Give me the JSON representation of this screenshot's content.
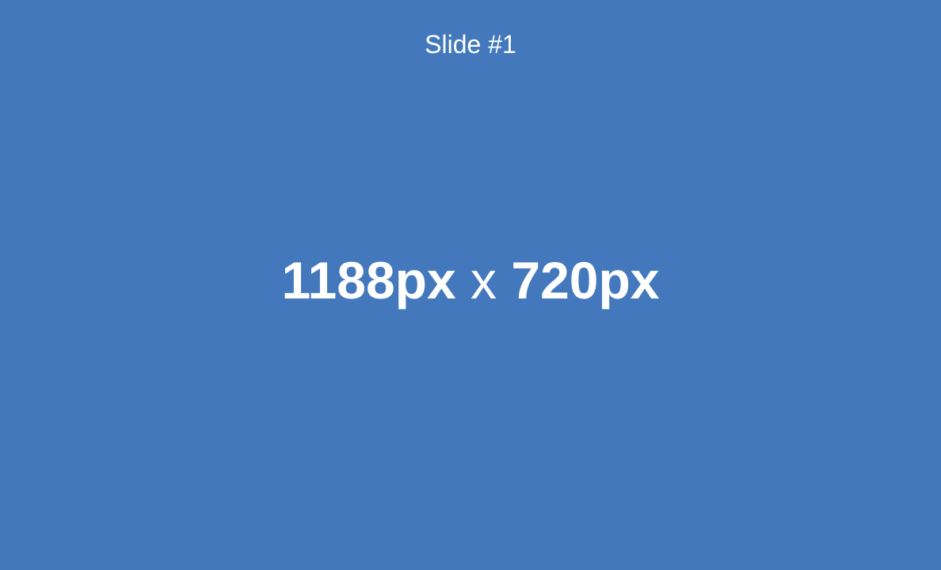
{
  "slide": {
    "label": "Slide #1",
    "width_text": "1188px",
    "separator": "x",
    "height_text": "720px"
  },
  "colors": {
    "background": "#4379bc",
    "text": "#ffffff"
  }
}
